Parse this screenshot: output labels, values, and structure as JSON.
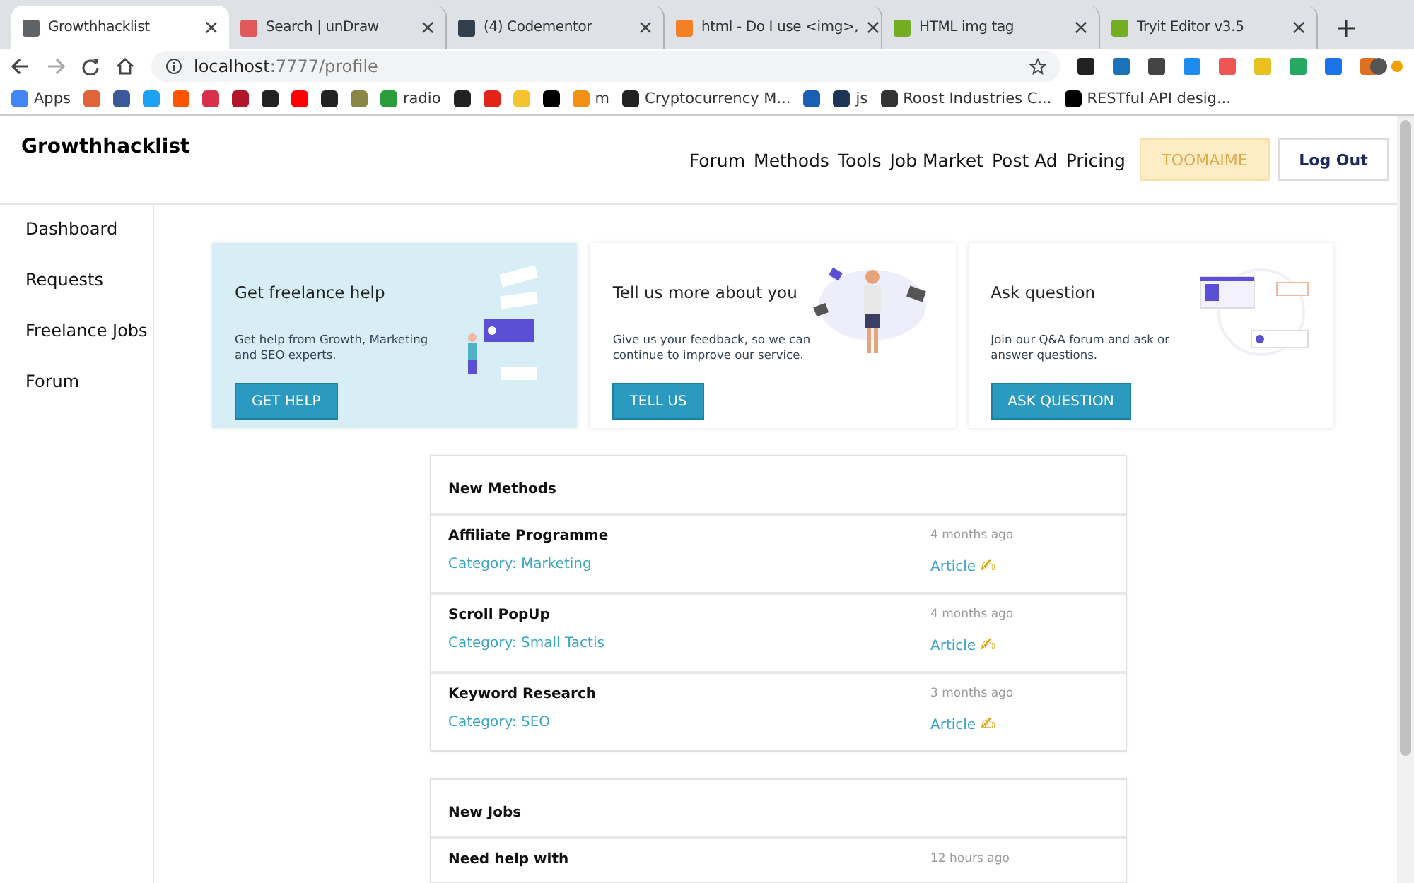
{
  "browser": {
    "tabs": [
      {
        "title": "Growthhacklist",
        "selected": true,
        "color": "#5f6368"
      },
      {
        "title": "Search | unDraw",
        "selected": false,
        "color": "#e0595b"
      },
      {
        "title": "(4) Codementor",
        "selected": false,
        "color": "#333f4d"
      },
      {
        "title": "html - Do I use <img>,",
        "selected": false,
        "color": "#f48024"
      },
      {
        "title": "HTML img tag",
        "selected": false,
        "color": "#73ad21"
      },
      {
        "title": "Tryit Editor v3.5",
        "selected": false,
        "color": "#73ad21"
      }
    ],
    "url_host": "localhost",
    "url_rest": ":7777/profile",
    "bookmarks": [
      {
        "label": "Apps",
        "color": "#4285f4"
      },
      {
        "color": "#e0643a"
      },
      {
        "color": "#3b5998"
      },
      {
        "color": "#1da1f2"
      },
      {
        "color": "#ff5500"
      },
      {
        "color": "#d8304a"
      },
      {
        "color": "#b0152a"
      },
      {
        "color": "#222222"
      },
      {
        "color": "#ff0000"
      },
      {
        "color": "#222222"
      },
      {
        "color": "#888844"
      },
      {
        "label": "radio",
        "color": "#2a9d3a"
      },
      {
        "color": "#222222"
      },
      {
        "color": "#e2231a"
      },
      {
        "color": "#f4c430"
      },
      {
        "color": "#000000"
      },
      {
        "label": "m",
        "color": "#f29111"
      },
      {
        "label": "Cryptocurrency M...",
        "color": "#222222"
      },
      {
        "color": "#1a5fb4"
      },
      {
        "label": "js",
        "color": "#1d3557"
      },
      {
        "label": "Roost Industries C...",
        "color": "#333333"
      },
      {
        "label": "RESTful API desig...",
        "color": "#000000"
      }
    ]
  },
  "site": {
    "logo": "Growthhacklist",
    "nav": [
      {
        "label": "Forum"
      },
      {
        "label": "Methods"
      },
      {
        "label": "Tools"
      },
      {
        "label": "Job Market"
      },
      {
        "label": "Post Ad"
      },
      {
        "label": "Pricing"
      }
    ],
    "user_button": "TOOMAIME",
    "logout_button": "Log Out"
  },
  "sidebar": {
    "items": [
      {
        "label": "Dashboard"
      },
      {
        "label": "Requests"
      },
      {
        "label": "Freelance Jobs"
      },
      {
        "label": "Forum"
      }
    ]
  },
  "cards": [
    {
      "title": "Get freelance help",
      "text": "Get help from Growth, Marketing and SEO experts.",
      "button": "GET HELP",
      "highlighted": true,
      "kind": "help"
    },
    {
      "title": "Tell us more about you",
      "text": "Give us your feedback, so we can continue to improve our service.",
      "button": "TELL US",
      "highlighted": false,
      "kind": "person"
    },
    {
      "title": "Ask question",
      "text": "Join our Q&A forum and ask or answer questions.",
      "button": "ASK QUESTION",
      "highlighted": false,
      "kind": "forum"
    }
  ],
  "panels": [
    {
      "title": "New Methods",
      "rows": [
        {
          "name": "Affiliate Programme",
          "category": "Category: Marketing",
          "time": "4 months ago",
          "tag": "Article",
          "tag_icon": "✍"
        },
        {
          "name": "Scroll PopUp",
          "category": "Category: Small Tactis",
          "time": "4 months ago",
          "tag": "Article",
          "tag_icon": "✍"
        },
        {
          "name": "Keyword Research",
          "category": "Category: SEO",
          "time": "3 months ago",
          "tag": "Article",
          "tag_icon": "✍"
        }
      ]
    },
    {
      "title": "New Jobs",
      "rows": [
        {
          "name": "Need help with",
          "time": "12 hours ago"
        }
      ]
    }
  ]
}
